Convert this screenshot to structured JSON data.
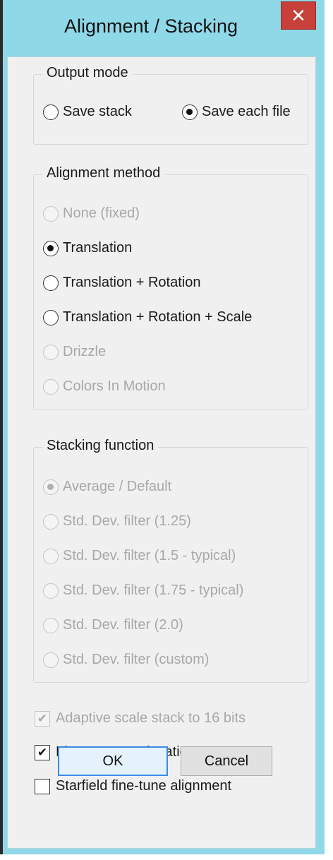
{
  "window": {
    "title": "Alignment / Stacking",
    "close_glyph": "✕"
  },
  "output_mode": {
    "title": "Output mode",
    "options": [
      {
        "label": "Save stack",
        "selected": false,
        "enabled": true
      },
      {
        "label": "Save each file",
        "selected": true,
        "enabled": true
      }
    ]
  },
  "alignment_method": {
    "title": "Alignment method",
    "options": [
      {
        "label": "None (fixed)",
        "selected": false,
        "enabled": false
      },
      {
        "label": "Translation",
        "selected": true,
        "enabled": true
      },
      {
        "label": "Translation + Rotation",
        "selected": false,
        "enabled": true
      },
      {
        "label": "Translation + Rotation + Scale",
        "selected": false,
        "enabled": true
      },
      {
        "label": "Drizzle",
        "selected": false,
        "enabled": false
      },
      {
        "label": "Colors In Motion",
        "selected": false,
        "enabled": false
      }
    ]
  },
  "stacking_function": {
    "title": "Stacking function",
    "options": [
      {
        "label": "Average / Default",
        "selected": true,
        "enabled": false
      },
      {
        "label": "Std. Dev. filter (1.25)",
        "selected": false,
        "enabled": false
      },
      {
        "label": "Std. Dev. filter (1.5 - typical)",
        "selected": false,
        "enabled": false
      },
      {
        "label": "Std. Dev. filter (1.75 - typical)",
        "selected": false,
        "enabled": false
      },
      {
        "label": "Std. Dev. filter (2.0)",
        "selected": false,
        "enabled": false
      },
      {
        "label": "Std. Dev. filter (custom)",
        "selected": false,
        "enabled": false
      }
    ]
  },
  "checkboxes": [
    {
      "label": "Adaptive scale stack to 16 bits",
      "checked": true,
      "enabled": false
    },
    {
      "label": "Fine-tune star location",
      "checked": true,
      "enabled": true
    },
    {
      "label": "Starfield fine-tune alignment",
      "checked": false,
      "enabled": true
    }
  ],
  "buttons": {
    "ok": "OK",
    "cancel": "Cancel"
  }
}
